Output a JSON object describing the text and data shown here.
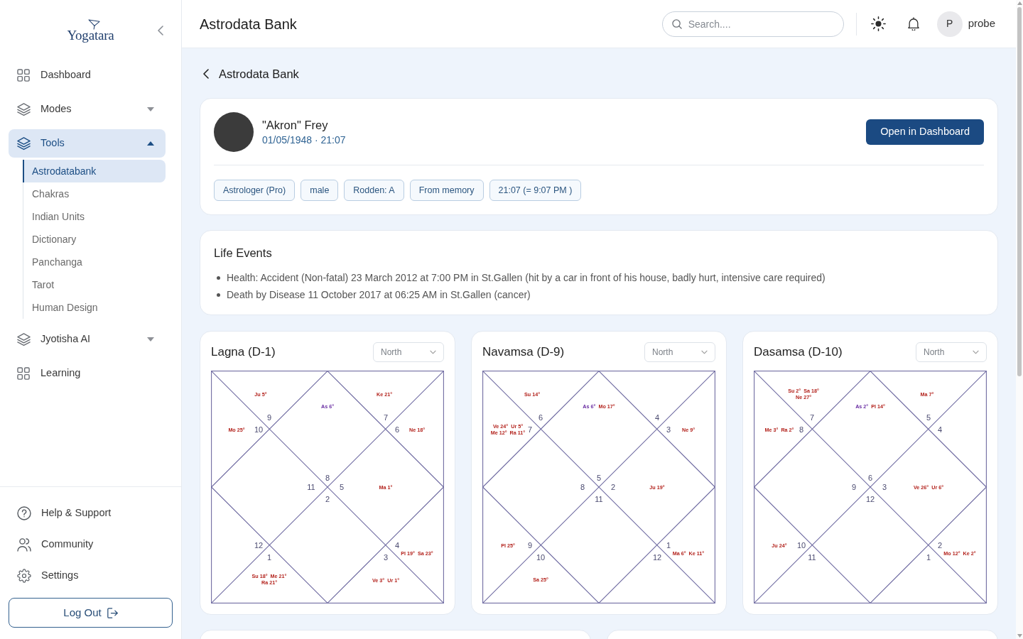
{
  "sidebar": {
    "logo": "Yogatara",
    "items": [
      {
        "kind": "link",
        "label": "Dashboard",
        "selected": false
      },
      {
        "kind": "group",
        "label": "Modes",
        "selected": false,
        "expanded": false
      },
      {
        "kind": "group",
        "label": "Tools",
        "selected": true,
        "expanded": true,
        "children": [
          {
            "label": "Astrodatabank",
            "selected": true
          },
          {
            "label": "Chakras",
            "selected": false
          },
          {
            "label": "Indian Units",
            "selected": false
          },
          {
            "label": "Dictionary",
            "selected": false
          },
          {
            "label": "Panchanga",
            "selected": false
          },
          {
            "label": "Tarot",
            "selected": false
          },
          {
            "label": "Human Design",
            "selected": false
          }
        ]
      },
      {
        "kind": "group",
        "label": "Jyotisha AI",
        "selected": false,
        "expanded": false
      },
      {
        "kind": "link",
        "label": "Learning",
        "selected": false
      }
    ],
    "footer_items": [
      "Help & Support",
      "Community",
      "Settings"
    ],
    "logout": "Log Out"
  },
  "header": {
    "title": "Astrodata Bank",
    "search": {
      "placeholder": "Search...."
    },
    "user": {
      "initial": "P",
      "name": "probe"
    }
  },
  "breadcrumb": "Astrodata Bank",
  "profile": {
    "name": "\"Akron\" Frey",
    "birth": "01/05/1948 · 21:07",
    "button": "Open in Dashboard",
    "tags": [
      "Astrologer (Pro)",
      "male",
      "Rodden: A",
      "From memory",
      "21:07 (= 9:07 PM )"
    ]
  },
  "life_events": {
    "title": "Life Events",
    "items": [
      "Health: Accident (Non-fatal) 23 March 2012 at 7:00 PM in St.Gallen (hit by a car in front of his house, badly hurt, intensive care required)",
      "Death by Disease 11 October 2017 at 06:25 AM in St.Gallen (cancer)"
    ]
  },
  "charts": [
    {
      "title": "Lagna (D-1)",
      "style": "North",
      "houses": [
        {
          "sign": "9",
          "planets": [
            {
              "text": "Ju 5°",
              "kind": "planet"
            }
          ]
        },
        {
          "sign": "8",
          "planets": [
            {
              "text": "As 6°",
              "kind": "ascendant"
            }
          ]
        },
        {
          "sign": "7",
          "planets": [
            {
              "text": "Ke 21°",
              "kind": "planet"
            }
          ]
        },
        {
          "sign": "10",
          "planets": [
            {
              "text": "Mo 25°",
              "kind": "planet"
            }
          ]
        },
        {
          "sign": "6",
          "planets": [
            {
              "text": "Ne 18°",
              "kind": "planet"
            }
          ]
        },
        {
          "sign": "11"
        },
        {
          "sign": "5",
          "planets": [
            {
              "text": "Ma 1°",
              "kind": "planet"
            }
          ]
        },
        {
          "sign": "2"
        },
        {
          "sign": "12"
        },
        {
          "sign": "4",
          "planets": [
            {
              "text": "Pl 19°",
              "kind": "planet"
            },
            {
              "text": "Sa 23°",
              "kind": "planet"
            }
          ]
        },
        {
          "sign": "1",
          "planets": [
            {
              "text": "Su 18°",
              "kind": "planet"
            },
            {
              "text": "Me 21°",
              "kind": "planet"
            },
            {
              "text": "Ra 21°",
              "kind": "planet"
            }
          ]
        },
        {
          "sign": "3",
          "planets": [
            {
              "text": "Ve 3°",
              "kind": "planet"
            },
            {
              "text": "Ur 1°",
              "kind": "planet"
            }
          ]
        }
      ]
    },
    {
      "title": "Navamsa (D-9)",
      "style": "North",
      "houses": [
        {
          "sign": "6",
          "planets": [
            {
              "text": "Su 14°",
              "kind": "planet"
            }
          ]
        },
        {
          "sign": "5",
          "planets": [
            {
              "text": "As 6°",
              "kind": "ascendant"
            },
            {
              "text": "Mo 17°",
              "kind": "planet"
            }
          ]
        },
        {
          "sign": "4"
        },
        {
          "sign": "7",
          "planets": [
            {
              "text": "Ve 24°",
              "kind": "planet"
            },
            {
              "text": "Ur 5°",
              "kind": "planet"
            },
            {
              "text": "Me 12°",
              "kind": "planet"
            },
            {
              "text": "Ra 11°",
              "kind": "planet"
            }
          ]
        },
        {
          "sign": "3",
          "planets": [
            {
              "text": "Ne 9°",
              "kind": "planet"
            }
          ]
        },
        {
          "sign": "8"
        },
        {
          "sign": "2",
          "planets": [
            {
              "text": "Ju 19°",
              "kind": "planet"
            }
          ]
        },
        {
          "sign": "11"
        },
        {
          "sign": "9",
          "planets": [
            {
              "text": "Pl 25°",
              "kind": "planet"
            }
          ]
        },
        {
          "sign": "1",
          "planets": [
            {
              "text": "Ma 6°",
              "kind": "planet"
            },
            {
              "text": "Ke 11°",
              "kind": "planet"
            }
          ]
        },
        {
          "sign": "10",
          "planets": [
            {
              "text": "Sa 25°",
              "kind": "planet"
            }
          ]
        },
        {
          "sign": "12"
        }
      ]
    },
    {
      "title": "Dasamsa (D-10)",
      "style": "North",
      "houses": [
        {
          "sign": "7",
          "planets": [
            {
              "text": "Su 2°",
              "kind": "planet"
            },
            {
              "text": "Sa 18°",
              "kind": "planet"
            },
            {
              "text": "Ne 27°",
              "kind": "planet"
            }
          ]
        },
        {
          "sign": "6",
          "planets": [
            {
              "text": "As 2°",
              "kind": "ascendant"
            },
            {
              "text": "Pl 14°",
              "kind": "planet"
            }
          ]
        },
        {
          "sign": "5",
          "planets": [
            {
              "text": "Ma 7°",
              "kind": "planet"
            }
          ]
        },
        {
          "sign": "8",
          "planets": [
            {
              "text": "Me 3°",
              "kind": "planet"
            },
            {
              "text": "Ra 2°",
              "kind": "planet"
            }
          ]
        },
        {
          "sign": "4"
        },
        {
          "sign": "9"
        },
        {
          "sign": "3",
          "planets": [
            {
              "text": "Ve 26°",
              "kind": "planet"
            },
            {
              "text": "Ur 6°",
              "kind": "planet"
            }
          ]
        },
        {
          "sign": "12"
        },
        {
          "sign": "10",
          "planets": [
            {
              "text": "Ju 24°",
              "kind": "planet"
            }
          ]
        },
        {
          "sign": "2",
          "planets": [
            {
              "text": "Mo 12°",
              "kind": "planet"
            },
            {
              "text": "Ke 2°",
              "kind": "planet"
            }
          ]
        },
        {
          "sign": "11"
        },
        {
          "sign": "1"
        }
      ]
    }
  ]
}
